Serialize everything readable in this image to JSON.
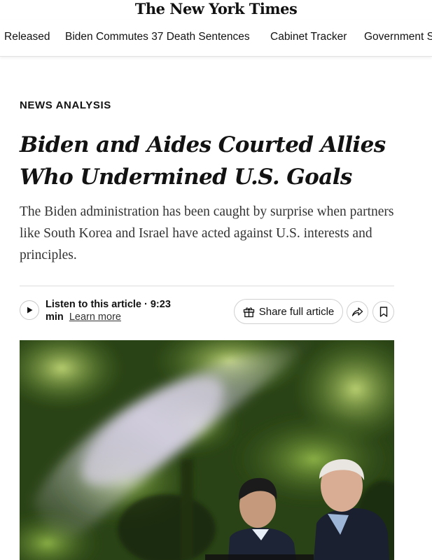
{
  "masthead": {
    "logo_text": "The New York Times"
  },
  "nav": {
    "items": [
      "Released",
      "Biden Commutes 37 Death Sentences",
      "Cabinet Tracker",
      "Government S"
    ]
  },
  "article": {
    "kicker": "NEWS ANALYSIS",
    "headline": "Biden and Aides Courted Allies Who Undermined U.S. Goals",
    "summary": "The Biden administration has been caught by surprise when partners like South Korea and Israel have acted against U.S. interests and principles."
  },
  "listen": {
    "label": "Listen to this article · 9:23",
    "unit": "min",
    "learn_more": "Learn more"
  },
  "actions": {
    "share_label": "Share full article",
    "icons": [
      "play-icon",
      "gift-icon",
      "share-arrow-icon",
      "bookmark-icon"
    ]
  },
  "photo": {
    "description_icon": "photo"
  }
}
